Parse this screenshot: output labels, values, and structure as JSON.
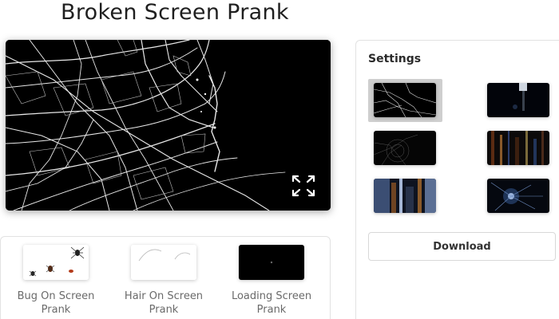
{
  "page": {
    "title": "Broken Screen Prank"
  },
  "settings": {
    "title": "Settings",
    "themes": [
      {
        "name": "cracked-glass-theme",
        "selected": true
      },
      {
        "name": "dark-flare-theme",
        "selected": false
      },
      {
        "name": "spiderweb-crack-theme",
        "selected": false
      },
      {
        "name": "glitch-lines-theme",
        "selected": false
      },
      {
        "name": "blue-glitch-theme",
        "selected": false
      },
      {
        "name": "blue-burst-theme",
        "selected": false
      }
    ],
    "download_label": "Download"
  },
  "pranks": [
    {
      "label_line1": "Bug On Screen",
      "label_line2": "Prank",
      "icon": "bugs-thumbnail"
    },
    {
      "label_line1": "Hair On Screen",
      "label_line2": "Prank",
      "icon": "hair-thumbnail"
    },
    {
      "label_line1": "Loading Screen",
      "label_line2": "Prank",
      "icon": "loading-thumbnail"
    }
  ],
  "colors": {
    "screen": "#000000",
    "crack": "#ffffff",
    "panel_border": "#e2e2e2"
  }
}
